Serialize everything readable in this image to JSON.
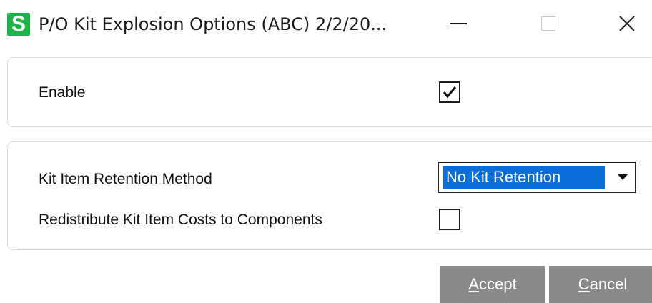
{
  "window": {
    "app_icon_letter": "S",
    "title": "P/O Kit Explosion Options (ABC) 2/2/20...",
    "controls": {
      "minimize": "minimize-icon",
      "maximize": "maximize-icon",
      "close": "close-icon"
    }
  },
  "enable_group": {
    "label": "Enable",
    "checked": true
  },
  "options_group": {
    "retention_label": "Kit Item Retention Method",
    "retention_value": "No Kit Retention",
    "redistribute_label": "Redistribute Kit Item Costs to Components",
    "redistribute_checked": false
  },
  "buttons": {
    "accept": {
      "mnemonic": "A",
      "rest": "ccept"
    },
    "cancel": {
      "mnemonic": "C",
      "rest": "ancel"
    }
  },
  "colors": {
    "app_icon": "#20b24a",
    "selection": "#0a6fd8",
    "button_bg": "#8a8a8a"
  }
}
